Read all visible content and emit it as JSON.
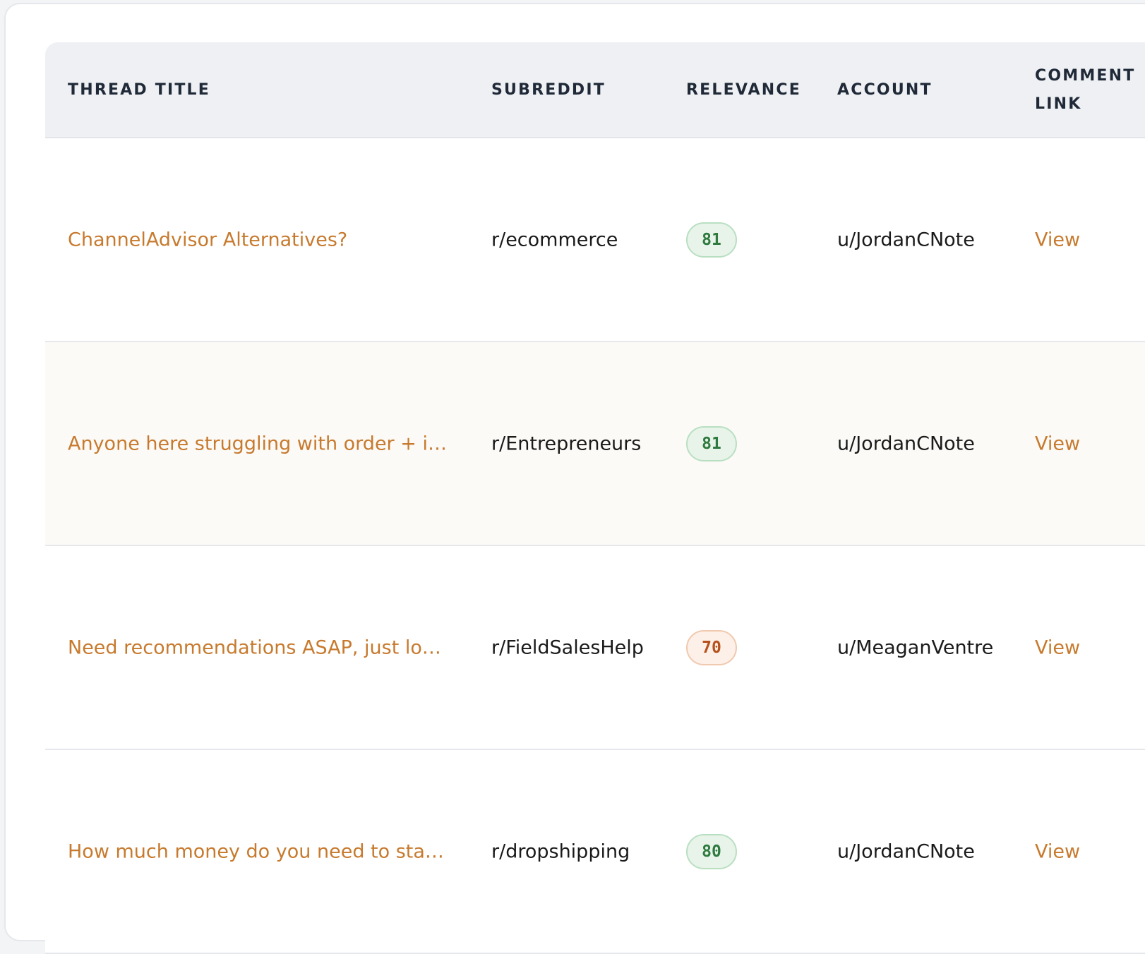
{
  "table": {
    "headers": {
      "thread_title": "THREAD TITLE",
      "subreddit": "SUBREDDIT",
      "relevance": "RELEVANCE",
      "account": "ACCOUNT",
      "comment_link": "COMMENT LINK"
    },
    "rows": [
      {
        "title": "ChannelAdvisor Alternatives?",
        "subreddit": "r/ecommerce",
        "relevance": "81",
        "relevance_color": "#2f7a3f",
        "account": "u/JordanCNote",
        "link": "View"
      },
      {
        "title": "Anyone here struggling with order + inv…",
        "subreddit": "r/Entrepreneurs",
        "relevance": "81",
        "relevance_color": "#2f7a3f",
        "account": "u/JordanCNote",
        "link": "View"
      },
      {
        "title": "Need recommendations ASAP, just lost …",
        "subreddit": "r/FieldSalesHelp",
        "relevance": "70",
        "relevance_color": "#b5521e",
        "account": "u/MeaganVentre",
        "link": "View"
      },
      {
        "title": "How much money do you need to start …",
        "subreddit": "r/dropshipping",
        "relevance": "80",
        "relevance_color": "#2f7a3f",
        "account": "u/JordanCNote",
        "link": "View"
      }
    ]
  },
  "colors": {
    "accent": "#c77a2e",
    "header_bg": "#eef0f3",
    "alt_row_bg": "#fbfaf7"
  }
}
